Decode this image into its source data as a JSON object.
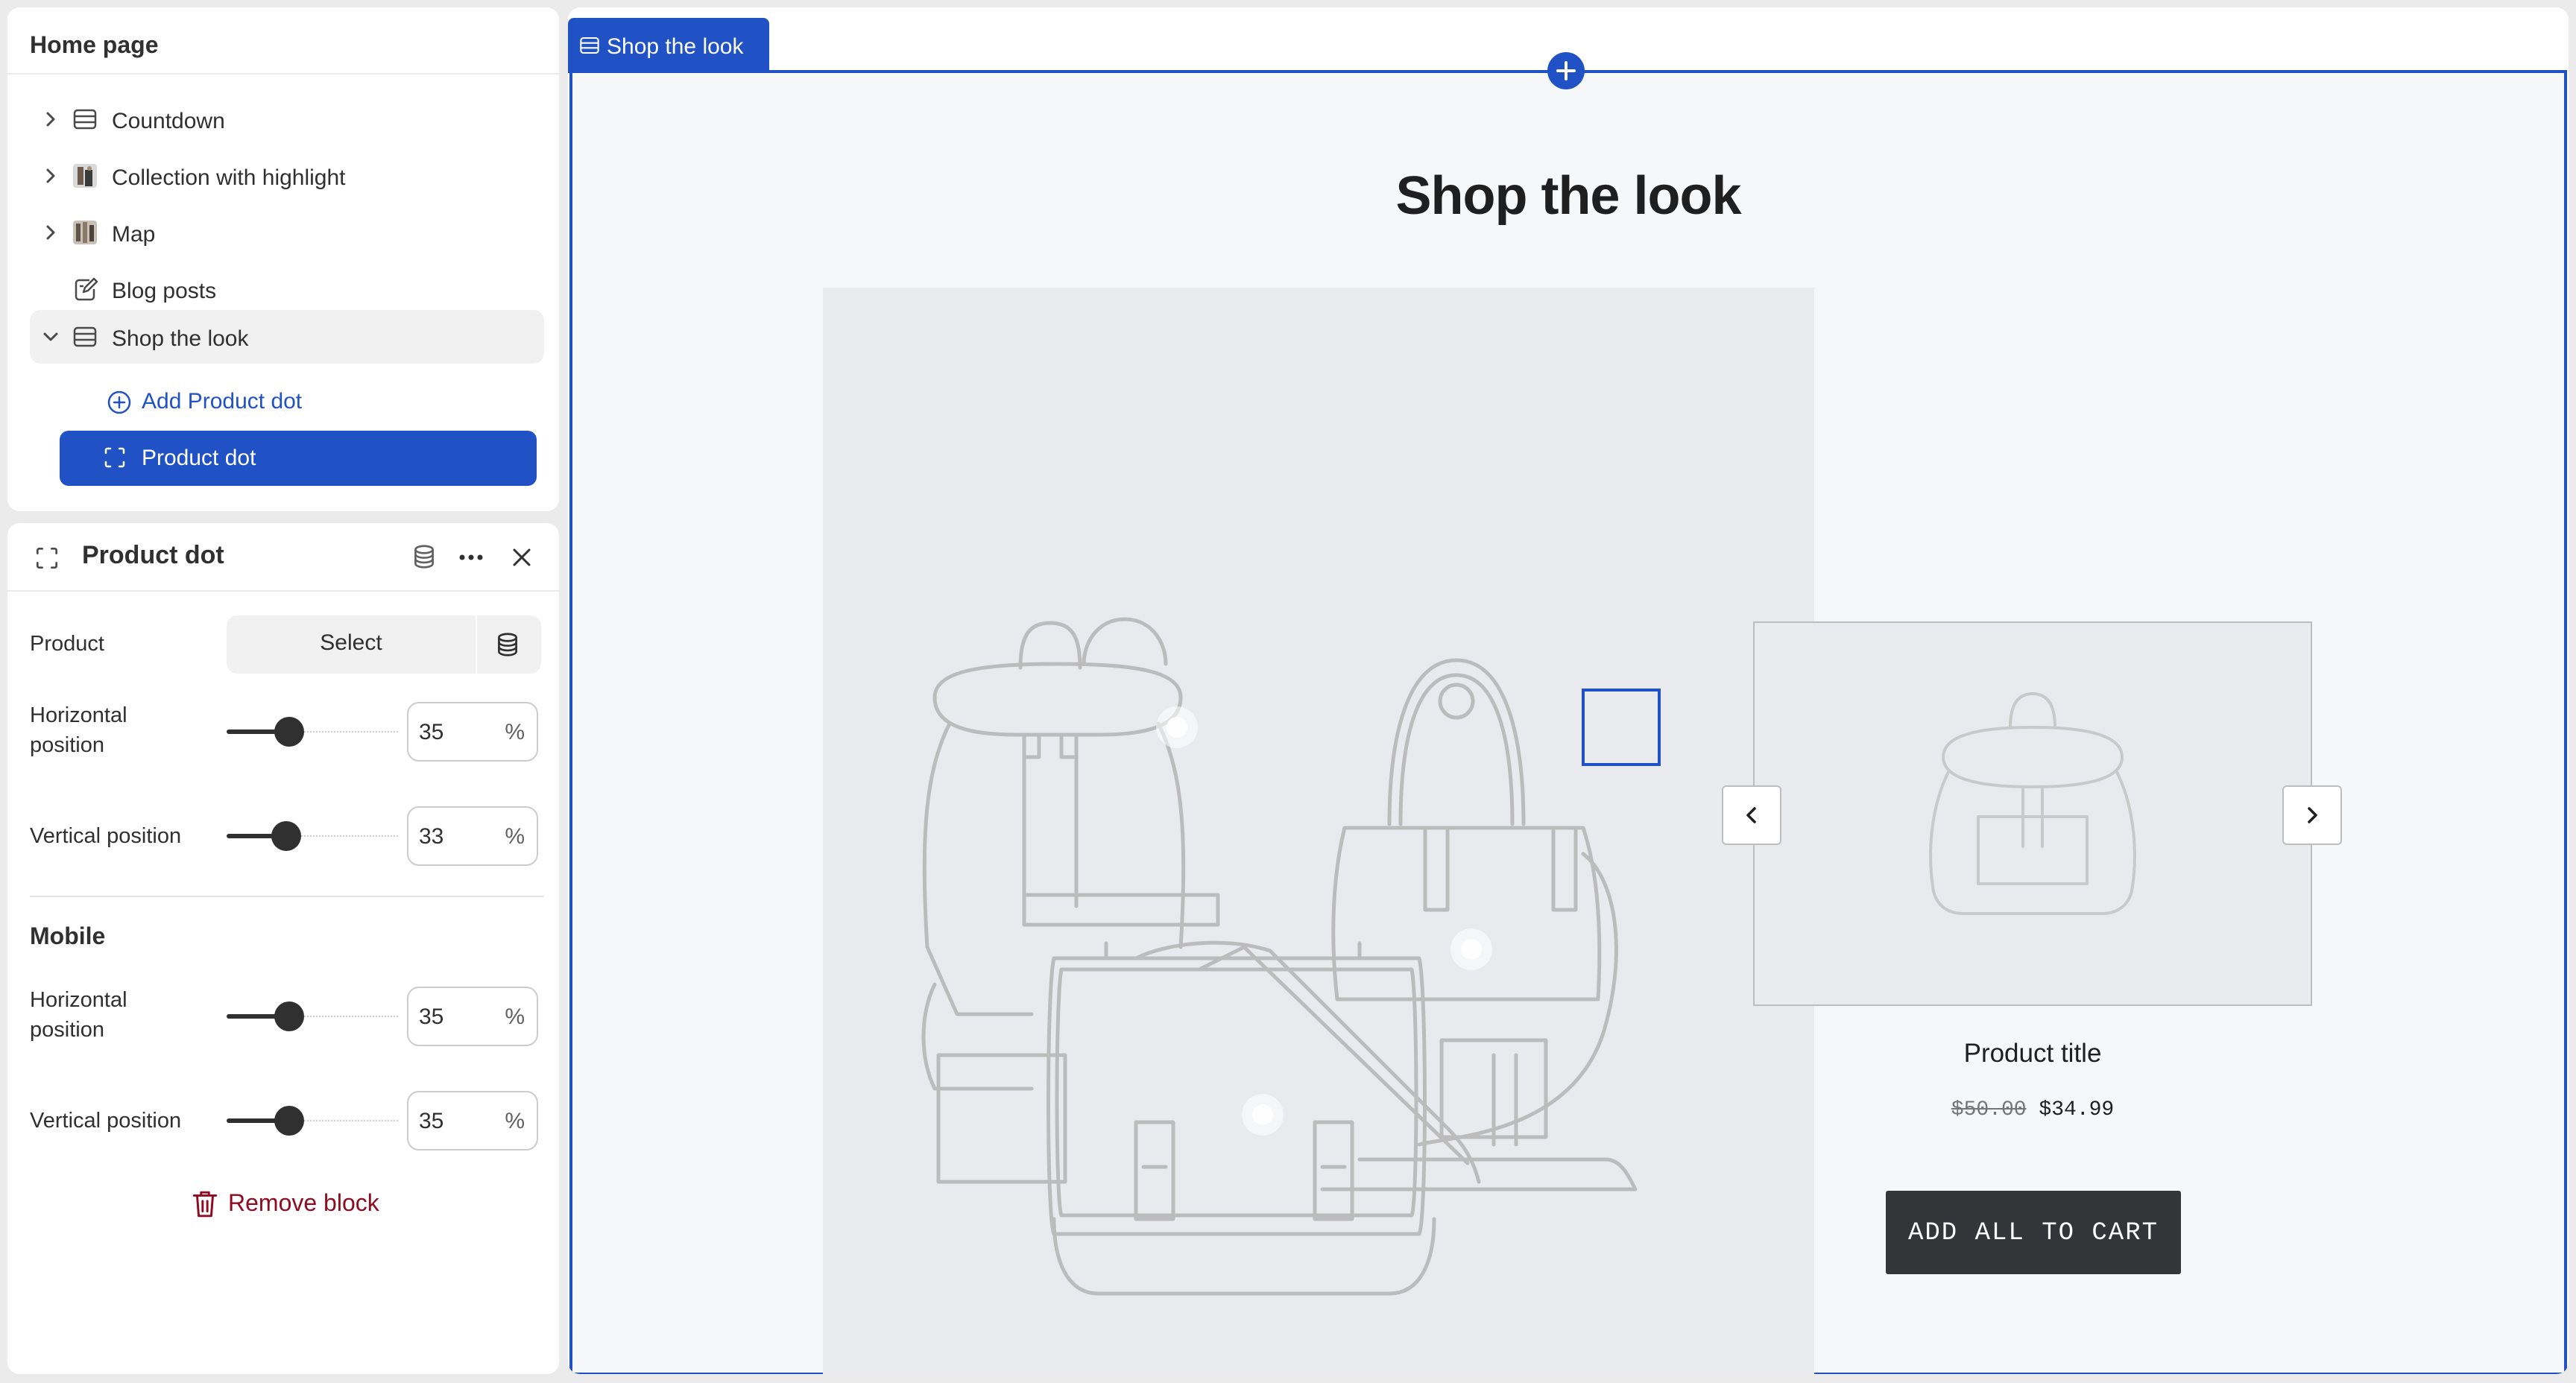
{
  "tree": {
    "title": "Home page",
    "items": [
      {
        "label": "Countdown",
        "icon": "section-icon",
        "expandable": true
      },
      {
        "label": "Collection with highlight",
        "icon": "image-thumb-icon",
        "expandable": true
      },
      {
        "label": "Map",
        "icon": "map-thumb-icon",
        "expandable": true
      },
      {
        "label": "Blog posts",
        "icon": "blog-icon",
        "expandable": false
      },
      {
        "label": "Shop the look",
        "icon": "section-icon",
        "expandable": true,
        "expanded": true,
        "selected": true
      }
    ],
    "add_block_label": "Add Product dot",
    "active_block_label": "Product dot"
  },
  "settings": {
    "title": "Product dot",
    "product_label": "Product",
    "select_label": "Select",
    "horizontal_label": "Horizontal position",
    "horizontal_value": "35",
    "vertical_label": "Vertical position",
    "vertical_value": "33",
    "unit": "%",
    "mobile_heading": "Mobile",
    "mobile_horizontal_label": "Horizontal position",
    "mobile_horizontal_value": "35",
    "mobile_vertical_label": "Vertical position",
    "mobile_vertical_value": "35",
    "remove_label": "Remove block"
  },
  "preview": {
    "section_tab": "Shop the look",
    "heading": "Shop the look",
    "product_title": "Product title",
    "compare_price": "$50.00",
    "price": "$34.99",
    "add_all_label": "ADD ALL TO CART"
  },
  "colors": {
    "accent": "#2052c6",
    "remove": "#8e0b21",
    "button_dark": "#333538"
  }
}
